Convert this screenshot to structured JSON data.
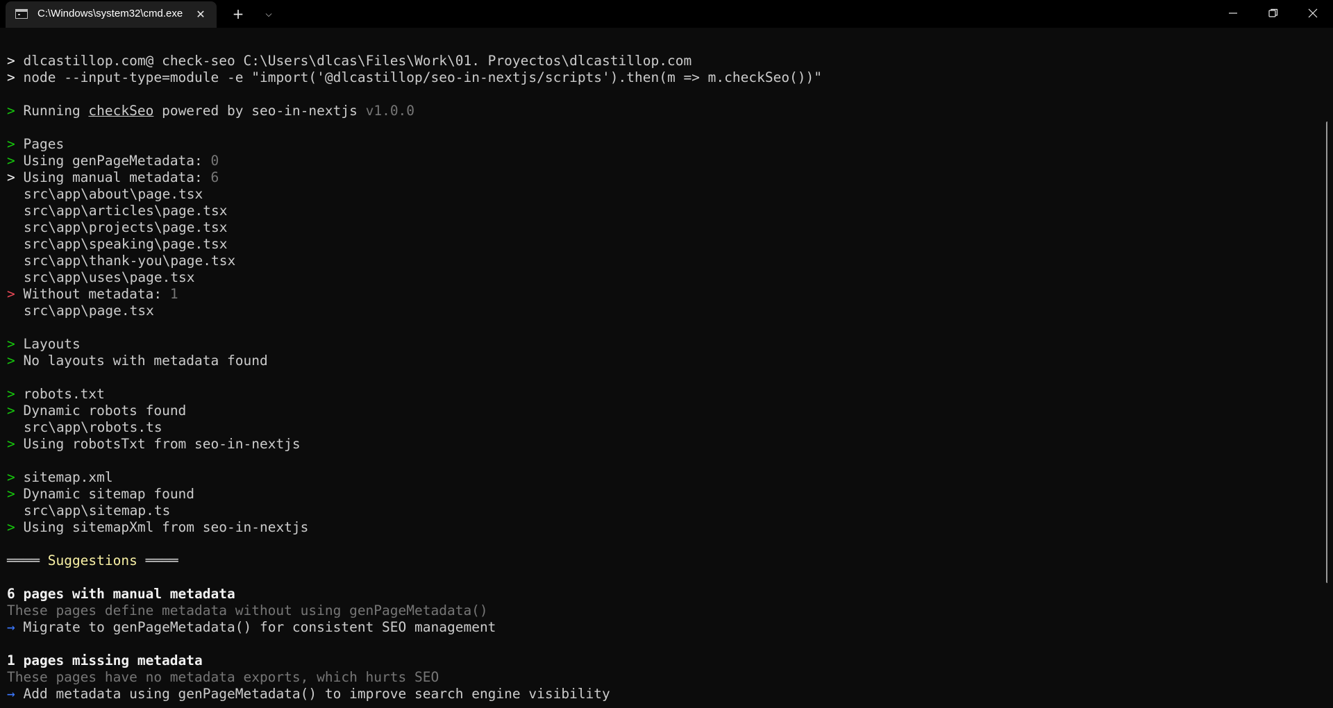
{
  "window": {
    "tab_title": "C:\\Windows\\system32\\cmd.exe",
    "tab_close": "✕",
    "new_tab": "+",
    "tab_dropdown": "⌵"
  },
  "terminal": {
    "cmd1": {
      "prompt": ">",
      "text": "dlcastillop.com@ check-seo C:\\Users\\dlcas\\Files\\Work\\01. Proyectos\\dlcastillop.com"
    },
    "cmd2": {
      "prompt": ">",
      "text": "node --input-type=module -e \"import('@dlcastillop/seo-in-nextjs/scripts').then(m => m.checkSeo())\""
    },
    "running": {
      "prompt": ">",
      "pre": "Running ",
      "tool": "checkSeo",
      "mid": " powered by seo-in-nextjs ",
      "version": "v1.0.0"
    },
    "pages": {
      "header": {
        "prompt": ">",
        "text": "Pages"
      },
      "gen": {
        "prompt": ">",
        "label": "Using genPageMetadata: ",
        "count": "0"
      },
      "manual": {
        "prompt": ">",
        "label": "Using manual metadata: ",
        "count": "6"
      },
      "manual_files": [
        "src\\app\\about\\page.tsx",
        "src\\app\\articles\\page.tsx",
        "src\\app\\projects\\page.tsx",
        "src\\app\\speaking\\page.tsx",
        "src\\app\\thank-you\\page.tsx",
        "src\\app\\uses\\page.tsx"
      ],
      "without": {
        "prompt": ">",
        "label": "Without metadata: ",
        "count": "1"
      },
      "without_files": [
        "src\\app\\page.tsx"
      ]
    },
    "layouts": {
      "header": {
        "prompt": ">",
        "text": "Layouts"
      },
      "status": {
        "prompt": ">",
        "text": "No layouts with metadata found"
      }
    },
    "robots": {
      "header": {
        "prompt": ">",
        "text": "robots.txt"
      },
      "status": {
        "prompt": ">",
        "text": "Dynamic robots found"
      },
      "file": "src\\app\\robots.ts",
      "using": {
        "prompt": ">",
        "text": "Using robotsTxt from seo-in-nextjs"
      }
    },
    "sitemap": {
      "header": {
        "prompt": ">",
        "text": "sitemap.xml"
      },
      "status": {
        "prompt": ">",
        "text": "Dynamic sitemap found"
      },
      "file": "src\\app\\sitemap.ts",
      "using": {
        "prompt": ">",
        "text": "Using sitemapXml from seo-in-nextjs"
      }
    },
    "suggestions": {
      "rule": "════",
      "title": "Suggestions",
      "items": [
        {
          "heading": "6 pages with manual metadata",
          "detail": "These pages define metadata without using genPageMetadata()",
          "arrow": "→",
          "action": "Migrate to genPageMetadata() for consistent SEO management"
        },
        {
          "heading": "1 pages missing metadata",
          "detail": "These pages have no metadata exports, which hurts SEO",
          "arrow": "→",
          "action": "Add metadata using genPageMetadata() to improve search engine visibility"
        }
      ]
    }
  },
  "colors": {
    "background": "#0c0c0c",
    "prompt_green": "#16c60c",
    "prompt_red": "#e74856",
    "arrow_blue": "#3b78ff",
    "dim_text": "#767676",
    "suggestions_yellow": "#f9f1a5"
  },
  "icons": {
    "tab": "terminal-icon",
    "minimize": "minimize-icon",
    "maximize": "restore-icon",
    "close": "close-icon"
  }
}
